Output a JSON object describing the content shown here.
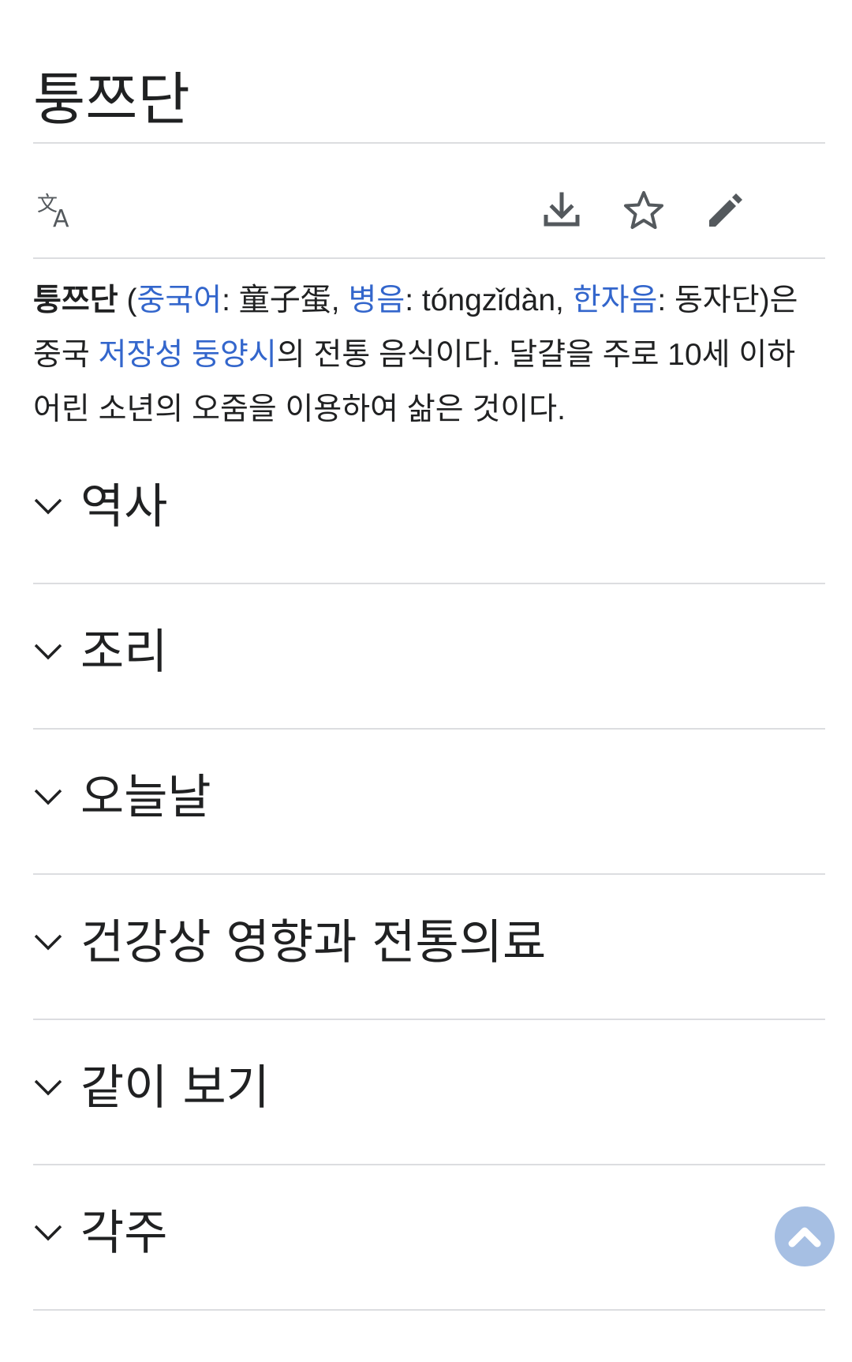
{
  "page": {
    "title": "퉁쯔단"
  },
  "toolbar": {
    "language_icon": "translate-icon",
    "download_icon": "download-icon",
    "watch_icon": "star-icon",
    "edit_icon": "pencil-icon"
  },
  "lead": {
    "term": "퉁쯔단",
    "open_paren": " (",
    "lang1_link": "중국어",
    "lang1_sep": ": ",
    "chinese": "童子蛋",
    "comma1": ", ",
    "lang2_link": "병음",
    "lang2_sep": ": ",
    "pinyin": "tóngzǐdàn",
    "comma2": ", ",
    "lang3_link": "한자음",
    "lang3_sep": ": ",
    "hanja_reading": "동자단",
    "close_paren": ")은",
    "line2_prefix": "중국 ",
    "link_province": "저장성",
    "space1": " ",
    "link_city": "둥양시",
    "rest": "의 전통 음식이다. 달걀을 주로 10세 이하 어린 소년의 오줌을 이용하여 삶은 것이다."
  },
  "sections": [
    {
      "label": "역사"
    },
    {
      "label": "조리"
    },
    {
      "label": "오늘날"
    },
    {
      "label": "건강상 영향과 전통의료"
    },
    {
      "label": "같이 보기"
    },
    {
      "label": "각주"
    }
  ],
  "colors": {
    "link": "#3366cc",
    "text": "#202122",
    "divider": "#dcdde0",
    "back_to_top": "#a6bfe3"
  },
  "back_to_top_icon": "chevron-up-icon"
}
